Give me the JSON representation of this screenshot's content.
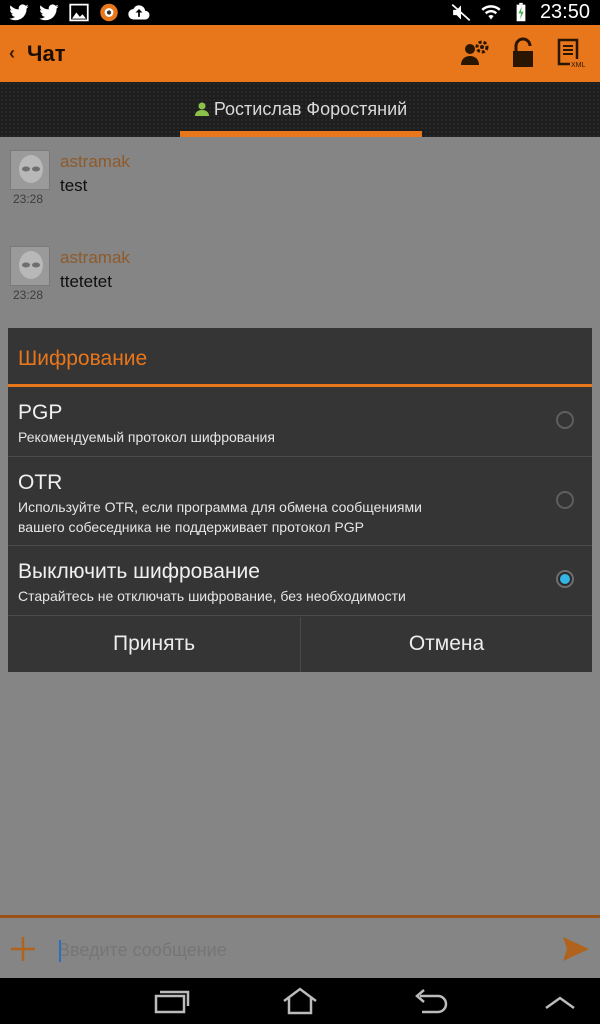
{
  "status_bar": {
    "time": "23:50",
    "left_icons": [
      "twitter-icon",
      "twitter-icon",
      "image-icon",
      "app-icon",
      "cloud-upload-icon"
    ],
    "right_icons": [
      "mute-icon",
      "wifi-icon",
      "battery-charging-icon"
    ]
  },
  "action_bar": {
    "title": "Чат",
    "back_icon": "chevron-left-icon",
    "actions": [
      "contact-settings-icon",
      "lock-icon",
      "xml-icon"
    ]
  },
  "tab": {
    "contact_name": "Ростислав Форостяний",
    "icon": "person-icon"
  },
  "messages": [
    {
      "author": "astramak",
      "text": "test",
      "time": "23:28"
    },
    {
      "author": "astramak",
      "text": "ttetetet",
      "time": "23:28"
    }
  ],
  "dialog": {
    "title": "Шифрование",
    "options": [
      {
        "title": "PGP",
        "description": "Рекомендуемый протокол шифрования",
        "selected": false
      },
      {
        "title": "OTR",
        "description_lines": [
          "Используйте OTR, если программа для обмена сообщениями",
          "вашего собеседника не поддерживает протокол PGP"
        ],
        "selected": false
      },
      {
        "title": "Выключить шифрование",
        "description": "Старайтесь не отключать шифрование, без необходимости",
        "selected": true
      }
    ],
    "accept_label": "Принять",
    "cancel_label": "Отмена"
  },
  "composer": {
    "placeholder": "Введите сообщение"
  },
  "colors": {
    "accent": "#e8761b",
    "radio_selected": "#33b5e5"
  },
  "navbar": [
    "recent-apps-icon",
    "home-icon",
    "back-icon",
    "menu-up-icon"
  ]
}
